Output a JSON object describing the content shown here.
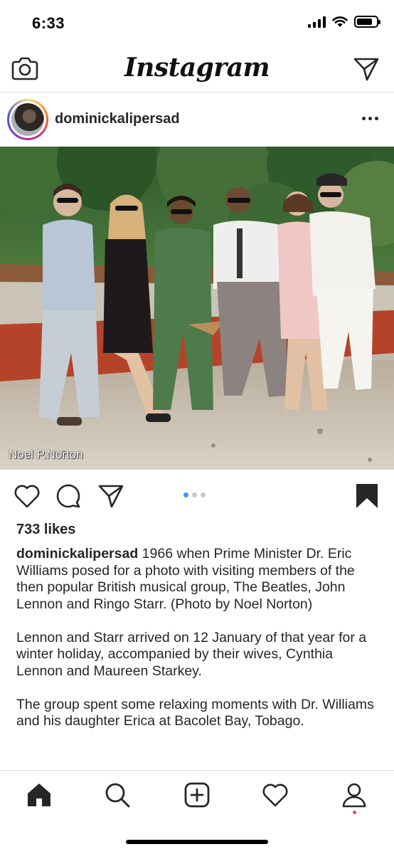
{
  "status_bar": {
    "time": "6:33"
  },
  "top_bar": {
    "logo": "Instagram",
    "left_icon": "camera-icon",
    "right_icon": "direct-message-icon"
  },
  "post": {
    "username": "dominickalipersad",
    "photo_watermark": "Noel P.Norton",
    "carousel": {
      "count": 3,
      "active_index": 0
    },
    "likes": "733 likes",
    "caption": {
      "username": "dominickalipersad",
      "paragraphs": [
        "1966 when Prime Minister Dr. Eric Williams posed for a photo with visiting members of the then popular British musical group, The Beatles, John Lennon and Ringo Starr. (Photo by Noel Norton)",
        "Lennon and Starr arrived on 12 January of that year for a winter holiday, accompanied by their wives, Cynthia Lennon and Maureen Starkey.",
        "The group spent some relaxing moments with Dr. Williams and his daughter Erica at Bacolet Bay, Tobago."
      ]
    }
  },
  "bottom_nav": {
    "items": [
      "home-icon",
      "search-icon",
      "new-post-icon",
      "activity-heart-icon",
      "profile-icon"
    ]
  },
  "colors": {
    "text": "#262626",
    "divider": "#dbdbdb",
    "carousel_active": "#3897f0",
    "notification_dot": "#ed4956"
  }
}
